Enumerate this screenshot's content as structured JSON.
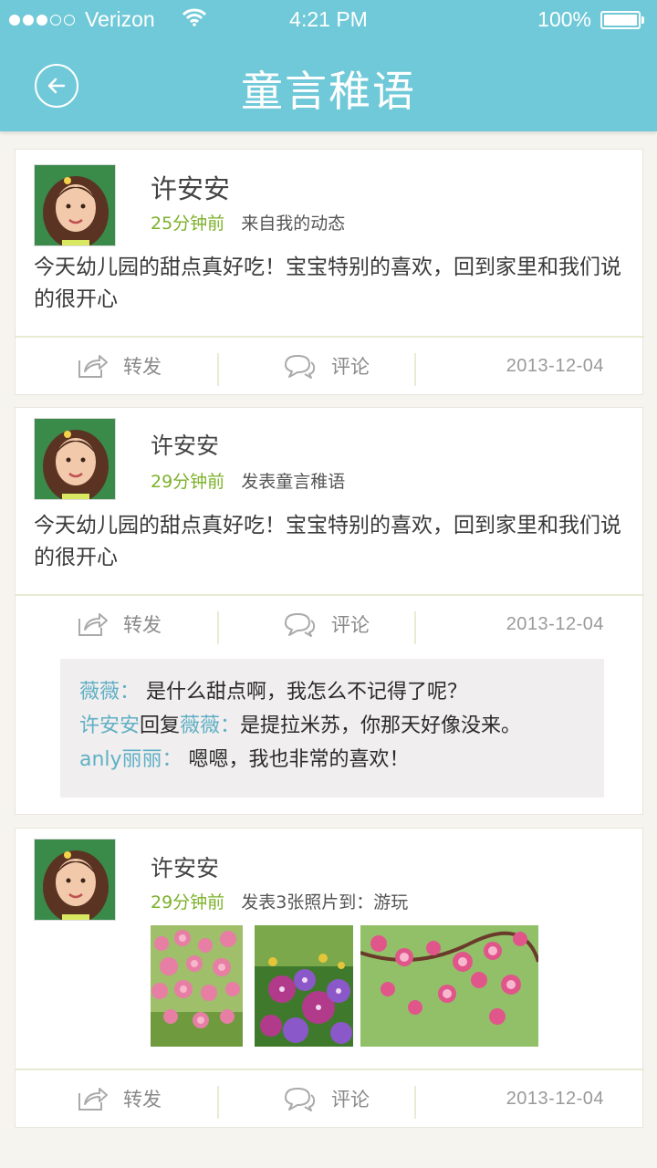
{
  "status_bar": {
    "carrier": "Verizon",
    "time": "4:21 PM",
    "battery": "100%",
    "signal_icon": "signal-dots-icon",
    "wifi_icon": "wifi-icon",
    "battery_icon": "battery-icon"
  },
  "header": {
    "title": "童言稚语",
    "back_icon": "back-arrow-circle-icon",
    "color": "#70c9d8"
  },
  "accent_colors": {
    "time_green": "#7cb12a",
    "commenter_blue": "#5fb0c5"
  },
  "posts": [
    {
      "username": "许安安",
      "time_ago": "25分钟前",
      "source": "来自我的动态",
      "content": "今天幼儿园的甜点真好吃！宝宝特别的喜欢，回到家里和我们说的很开心",
      "share_label": "转发",
      "comment_label": "评论",
      "date": "2013-12-04"
    },
    {
      "username": "许安安",
      "time_ago": "29分钟前",
      "source": "发表童言稚语",
      "content": "今天幼儿园的甜点真好吃！宝宝特别的喜欢，回到家里和我们说的很开心",
      "share_label": "转发",
      "comment_label": "评论",
      "date": "2013-12-04",
      "comments": [
        {
          "who": "薇薇：",
          "text": "  是什么甜点啊，我怎么不记得了呢？"
        },
        {
          "who": "许安安",
          "mid": "回复",
          "target": "薇薇：",
          "text": "是提拉米苏，你那天好像没来。"
        },
        {
          "who": "anly丽丽：",
          "text": " 嗯嗯，我也非常的喜欢！"
        }
      ]
    },
    {
      "username": "许安安",
      "time_ago": "29分钟前",
      "source": "发表3张照片到：游玩",
      "share_label": "转发",
      "comment_label": "评论",
      "date": "2013-12-04",
      "photos": [
        "pink-flowers-photo",
        "purple-petunias-photo",
        "pink-blossoms-photo"
      ]
    }
  ]
}
